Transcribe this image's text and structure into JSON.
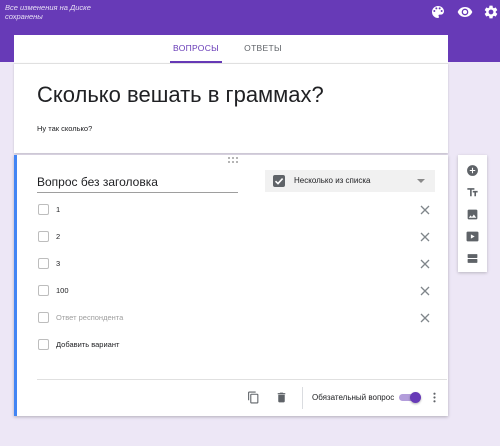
{
  "header": {
    "save_status": "Все изменения на Диске сохранены",
    "accent_color": "#673ab7",
    "icons": [
      "palette-icon",
      "eye-icon",
      "gear-icon"
    ]
  },
  "tabs": [
    {
      "label": "ВОПРОСЫ",
      "active": true
    },
    {
      "label": "ОТВЕТЫ",
      "active": false
    }
  ],
  "form": {
    "title": "Сколько вешать в граммах?",
    "description": "Ну так сколько?"
  },
  "question": {
    "title": "Вопрос без заголовка",
    "type_label": "Несколько из списка",
    "options": [
      {
        "label": "1"
      },
      {
        "label": "2"
      },
      {
        "label": "3"
      },
      {
        "label": "100"
      }
    ],
    "other_option_placeholder": "Ответ респондента",
    "add_option_label": "Добавить вариант",
    "required_label": "Обязательный вопрос",
    "required": true,
    "footer_icons": [
      "copy-icon",
      "trash-icon",
      "more-vert-icon"
    ]
  },
  "side_toolbar": {
    "icons": [
      "add-question-icon",
      "add-title-icon",
      "add-image-icon",
      "add-video-icon",
      "add-section-icon"
    ]
  }
}
